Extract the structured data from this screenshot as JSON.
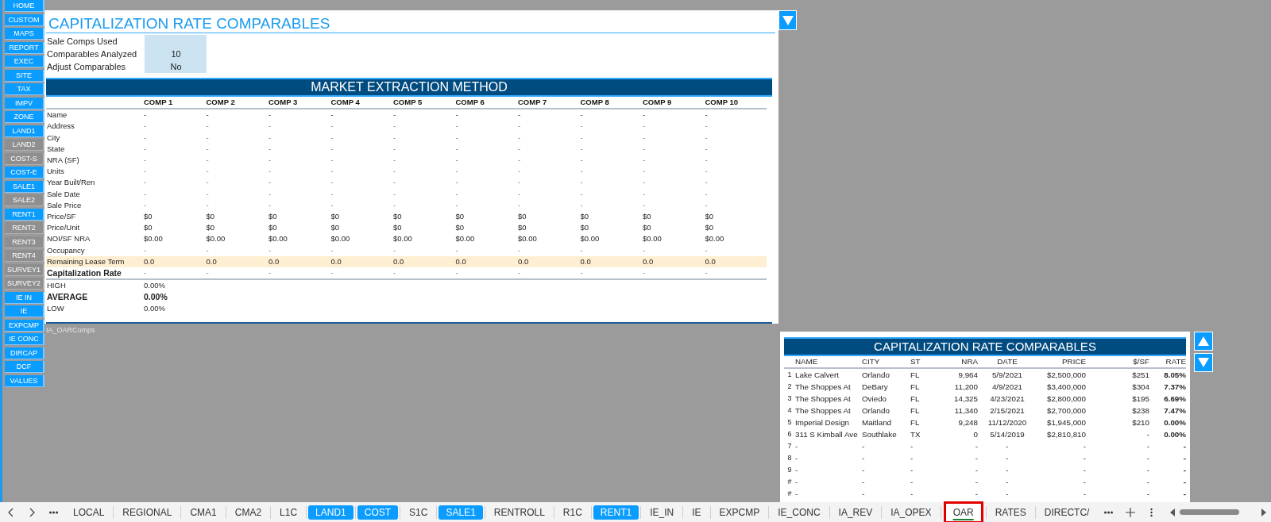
{
  "sidebar": {
    "buttons": [
      {
        "label": "HOME",
        "disabled": false
      },
      {
        "label": "CUSTOM",
        "disabled": false
      },
      {
        "label": "MAPS",
        "disabled": false
      },
      {
        "label": "REPORT",
        "disabled": false
      },
      {
        "label": "EXEC",
        "disabled": false
      },
      {
        "label": "SITE",
        "disabled": false
      },
      {
        "label": "TAX",
        "disabled": false
      },
      {
        "label": "IMPV",
        "disabled": false
      },
      {
        "label": "ZONE",
        "disabled": false
      },
      {
        "label": "LAND1",
        "disabled": false
      },
      {
        "label": "LAND2",
        "disabled": true
      },
      {
        "label": "COST-S",
        "disabled": true
      },
      {
        "label": "COST-E",
        "disabled": false
      },
      {
        "label": "SALE1",
        "disabled": false
      },
      {
        "label": "SALE2",
        "disabled": true
      },
      {
        "label": "RENT1",
        "disabled": false
      },
      {
        "label": "RENT2",
        "disabled": true
      },
      {
        "label": "RENT3",
        "disabled": true
      },
      {
        "label": "RENT4",
        "disabled": true
      },
      {
        "label": "SURVEY1",
        "disabled": true
      },
      {
        "label": "SURVEY2",
        "disabled": true
      },
      {
        "label": "IE IN",
        "disabled": false
      },
      {
        "label": "IE",
        "disabled": false
      },
      {
        "label": "EXPCMP",
        "disabled": false
      },
      {
        "label": "IE CONC",
        "disabled": false
      },
      {
        "label": "DIRCAP",
        "disabled": false
      },
      {
        "label": "DCF",
        "disabled": false
      },
      {
        "label": "VALUES",
        "disabled": false
      }
    ]
  },
  "panel": {
    "title": "CAPITALIZATION RATE COMPARABLES",
    "settings": [
      {
        "label": "Sale Comps Used"
      },
      {
        "label": "Comparables Analyzed",
        "value": "10"
      },
      {
        "label": "Adjust Comparables",
        "value": "No"
      }
    ],
    "market_extraction": {
      "title": "MARKET EXTRACTION METHOD",
      "columns": [
        "COMP 1",
        "COMP 2",
        "COMP 3",
        "COMP 4",
        "COMP 5",
        "COMP 6",
        "COMP 7",
        "COMP 8",
        "COMP 9",
        "COMP 10"
      ],
      "rows": [
        {
          "label": "Name",
          "kind": "plain",
          "values": [
            "-",
            "-",
            "-",
            "-",
            "-",
            "-",
            "-",
            "-",
            "-",
            "-"
          ]
        },
        {
          "label": "Address",
          "kind": "plain",
          "values": [
            "-",
            "-",
            "-",
            "-",
            "-",
            "-",
            "-",
            "-",
            "-",
            "-"
          ]
        },
        {
          "label": "City",
          "kind": "plain",
          "values": [
            "-",
            "-",
            "-",
            "-",
            "-",
            "-",
            "-",
            "-",
            "-",
            "-"
          ]
        },
        {
          "label": "State",
          "kind": "plain",
          "values": [
            "-",
            "-",
            "-",
            "-",
            "-",
            "-",
            "-",
            "-",
            "-",
            "-"
          ]
        },
        {
          "label": "NRA (SF)",
          "kind": "plain",
          "values": [
            "-",
            "-",
            "-",
            "-",
            "-",
            "-",
            "-",
            "-",
            "-",
            "-"
          ]
        },
        {
          "label": "Units",
          "kind": "plain",
          "values": [
            "-",
            "-",
            "-",
            "-",
            "-",
            "-",
            "-",
            "-",
            "-",
            "-"
          ]
        },
        {
          "label": "Year Built/Ren",
          "kind": "plain",
          "values": [
            "-",
            "-",
            "-",
            "-",
            "-",
            "-",
            "-",
            "-",
            "-",
            "-"
          ]
        },
        {
          "label": "Sale Date",
          "kind": "plain",
          "values": [
            "-",
            "-",
            "-",
            "-",
            "-",
            "-",
            "-",
            "-",
            "-",
            "-"
          ]
        },
        {
          "label": "Sale Price",
          "kind": "plain",
          "values": [
            "-",
            "-",
            "-",
            "-",
            "-",
            "-",
            "-",
            "-",
            "-",
            "-"
          ]
        },
        {
          "label": "Price/SF",
          "kind": "plain",
          "values": [
            "$0",
            "$0",
            "$0",
            "$0",
            "$0",
            "$0",
            "$0",
            "$0",
            "$0",
            "$0"
          ]
        },
        {
          "label": "Price/Unit",
          "kind": "plain",
          "values": [
            "$0",
            "$0",
            "$0",
            "$0",
            "$0",
            "$0",
            "$0",
            "$0",
            "$0",
            "$0"
          ]
        },
        {
          "label": "NOI/SF NRA",
          "kind": "plain",
          "values": [
            "$0.00",
            "$0.00",
            "$0.00",
            "$0.00",
            "$0.00",
            "$0.00",
            "$0.00",
            "$0.00",
            "$0.00",
            "$0.00"
          ]
        },
        {
          "label": "Occupancy",
          "kind": "plain",
          "values": [
            "-",
            "-",
            "-",
            "-",
            "-",
            "-",
            "-",
            "-",
            "-",
            "-"
          ]
        },
        {
          "label": "Remaining Lease Term",
          "kind": "shaded",
          "values": [
            "0.0",
            "0.0",
            "0.0",
            "0.0",
            "0.0",
            "0.0",
            "0.0",
            "0.0",
            "0.0",
            "0.0"
          ]
        },
        {
          "label": "Capitalization Rate",
          "kind": "bold",
          "values": [
            "-",
            "-",
            "-",
            "-",
            "-",
            "-",
            "-",
            "-",
            "-",
            "-"
          ]
        }
      ],
      "summary": [
        {
          "label": "HIGH",
          "value": "0.00%",
          "bold": false
        },
        {
          "label": "AVERAGE",
          "value": "0.00%",
          "bold": true
        },
        {
          "label": "LOW",
          "value": "0.00%",
          "bold": false
        }
      ]
    }
  },
  "sheet_label": "IA_OARComps",
  "comparables": {
    "title": "CAPITALIZATION RATE COMPARABLES",
    "columns": [
      "NAME",
      "CITY",
      "ST",
      "NRA",
      "DATE",
      "PRICE",
      "$/SF",
      "RATE"
    ],
    "rows": [
      {
        "number": "1",
        "values": [
          "Lake Calvert",
          "Orlando",
          "FL",
          "9,964",
          "5/9/2021",
          "$2,500,000",
          "$251",
          "8.05%"
        ]
      },
      {
        "number": "2",
        "values": [
          "The Shoppes At",
          "DeBary",
          "FL",
          "11,200",
          "4/9/2021",
          "$3,400,000",
          "$304",
          "7.37%"
        ]
      },
      {
        "number": "3",
        "values": [
          "The Shoppes At",
          "Oviedo",
          "FL",
          "14,325",
          "4/23/2021",
          "$2,800,000",
          "$195",
          "6.69%"
        ]
      },
      {
        "number": "4",
        "values": [
          "The Shoppes At",
          "Orlando",
          "FL",
          "11,340",
          "2/15/2021",
          "$2,700,000",
          "$238",
          "7.47%"
        ]
      },
      {
        "number": "5",
        "values": [
          "Imperial Design",
          "Maitland",
          "FL",
          "9,248",
          "11/12/2020",
          "$1,945,000",
          "$210",
          "0.00%"
        ]
      },
      {
        "number": "6",
        "values": [
          "311 S Kimball Ave",
          "Southlake",
          "TX",
          "0",
          "5/14/2019",
          "$2,810,810",
          "-",
          "0.00%"
        ]
      },
      {
        "number": "7",
        "values": [
          "-",
          "-",
          "-",
          "-",
          "-",
          "-",
          "-",
          "-"
        ]
      },
      {
        "number": "8",
        "values": [
          "-",
          "-",
          "-",
          "-",
          "-",
          "-",
          "-",
          "-"
        ]
      },
      {
        "number": "9",
        "values": [
          "-",
          "-",
          "-",
          "-",
          "-",
          "-",
          "-",
          "-"
        ]
      },
      {
        "number": "#",
        "values": [
          "-",
          "-",
          "-",
          "-",
          "-",
          "-",
          "-",
          "-"
        ]
      },
      {
        "number": "#",
        "values": [
          "-",
          "-",
          "-",
          "-",
          "-",
          "-",
          "-",
          "-"
        ]
      }
    ]
  },
  "sheet_tabs": {
    "tabs": [
      {
        "label": "LOCAL",
        "colored": false,
        "selected": false
      },
      {
        "label": "REGIONAL",
        "colored": false,
        "selected": false
      },
      {
        "label": "CMA1",
        "colored": false,
        "selected": false
      },
      {
        "label": "CMA2",
        "colored": false,
        "selected": false
      },
      {
        "label": "L1C",
        "colored": false,
        "selected": false
      },
      {
        "label": "LAND1",
        "colored": true,
        "selected": false
      },
      {
        "label": "COST",
        "colored": true,
        "selected": false
      },
      {
        "label": "S1C",
        "colored": false,
        "selected": false
      },
      {
        "label": "SALE1",
        "colored": true,
        "selected": false
      },
      {
        "label": "RENTROLL",
        "colored": false,
        "selected": false
      },
      {
        "label": "R1C",
        "colored": false,
        "selected": false
      },
      {
        "label": "RENT1",
        "colored": true,
        "selected": false
      },
      {
        "label": "IE_IN",
        "colored": false,
        "selected": false
      },
      {
        "label": "IE",
        "colored": false,
        "selected": false
      },
      {
        "label": "EXPCMP",
        "colored": false,
        "selected": false
      },
      {
        "label": "IE_CONC",
        "colored": false,
        "selected": false
      },
      {
        "label": "IA_REV",
        "colored": false,
        "selected": false
      },
      {
        "label": "IA_OPEX",
        "colored": false,
        "selected": false
      },
      {
        "label": "OAR",
        "colored": false,
        "selected": true
      },
      {
        "label": "RATES",
        "colored": false,
        "selected": false
      },
      {
        "label": "DIRECTC/",
        "colored": false,
        "selected": false
      }
    ]
  }
}
